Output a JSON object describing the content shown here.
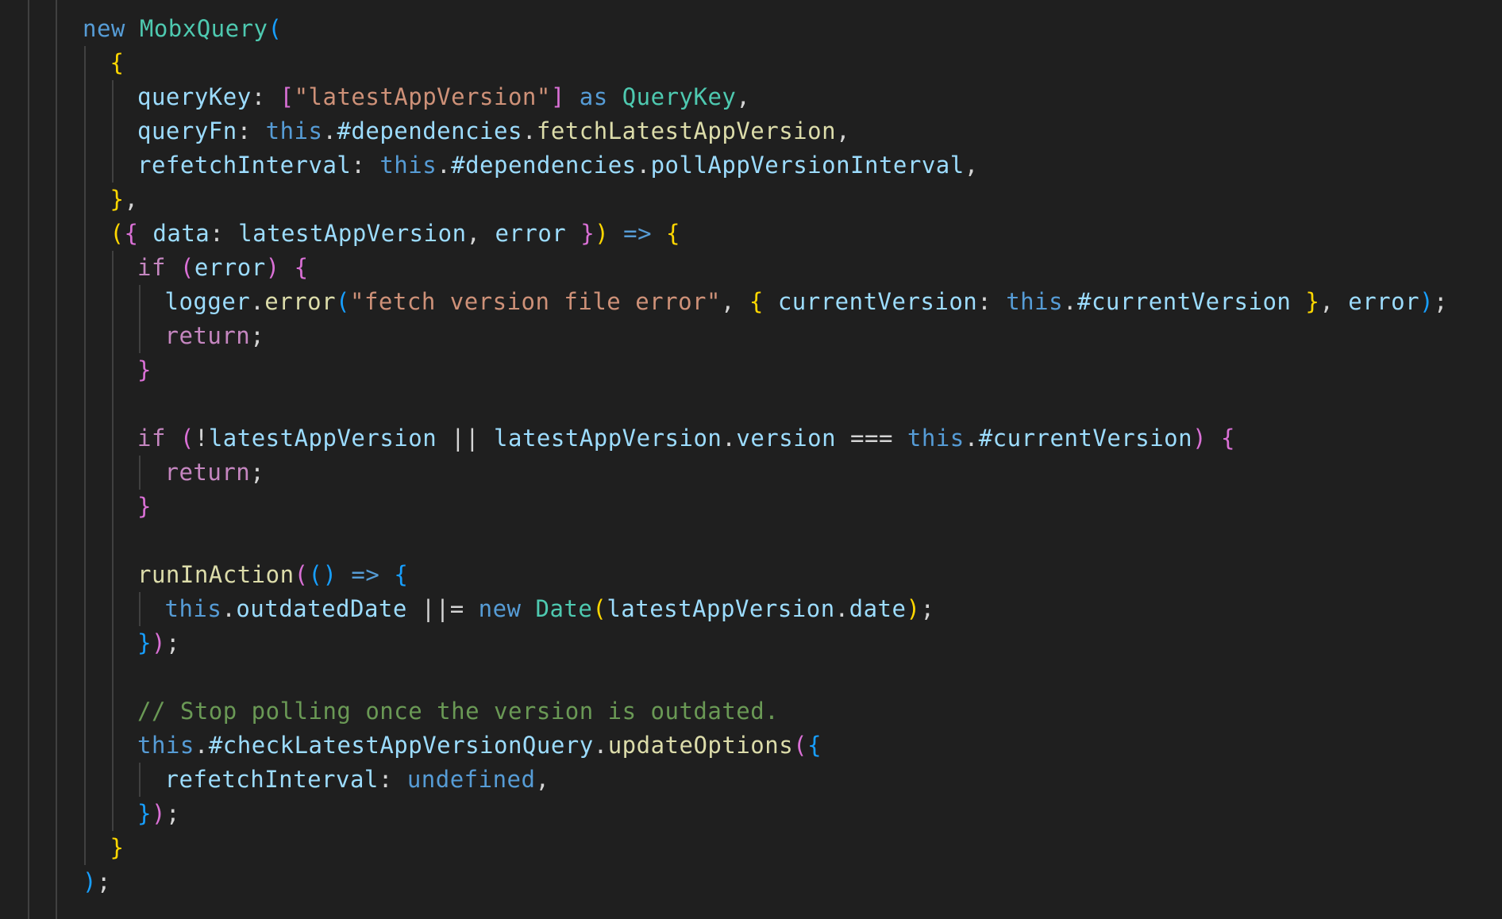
{
  "editor": {
    "language": "typescript",
    "theme": {
      "background": "#1f1f1f",
      "indent_guide": "#404040",
      "colors": {
        "keyword": "#569cd6",
        "control": "#c586c0",
        "type": "#4ec9b0",
        "variable": "#9cdcfe",
        "function": "#dcdcaa",
        "string": "#ce9178",
        "comment": "#6a9955",
        "punctuation": "#d4d4d4",
        "bracket1": "#ffd700",
        "bracket2": "#da70d6",
        "bracket3": "#179fff"
      }
    },
    "lines": [
      {
        "indent": 0,
        "tokens": [
          [
            "new",
            "keyword"
          ],
          [
            " ",
            "punctuation"
          ],
          [
            "MobxQuery",
            "type"
          ],
          [
            "(",
            "bracket3"
          ]
        ]
      },
      {
        "indent": 1,
        "tokens": [
          [
            "{",
            "bracket1"
          ]
        ]
      },
      {
        "indent": 2,
        "tokens": [
          [
            "queryKey",
            "variable"
          ],
          [
            ": ",
            "punctuation"
          ],
          [
            "[",
            "bracket2"
          ],
          [
            "\"latestAppVersion\"",
            "string"
          ],
          [
            "]",
            "bracket2"
          ],
          [
            " ",
            "punctuation"
          ],
          [
            "as",
            "keyword"
          ],
          [
            " ",
            "punctuation"
          ],
          [
            "QueryKey",
            "type"
          ],
          [
            ",",
            "punctuation"
          ]
        ]
      },
      {
        "indent": 2,
        "tokens": [
          [
            "queryFn",
            "variable"
          ],
          [
            ": ",
            "punctuation"
          ],
          [
            "this",
            "keyword"
          ],
          [
            ".",
            "punctuation"
          ],
          [
            "#dependencies",
            "variable"
          ],
          [
            ".",
            "punctuation"
          ],
          [
            "fetchLatestAppVersion",
            "function"
          ],
          [
            ",",
            "punctuation"
          ]
        ]
      },
      {
        "indent": 2,
        "tokens": [
          [
            "refetchInterval",
            "variable"
          ],
          [
            ": ",
            "punctuation"
          ],
          [
            "this",
            "keyword"
          ],
          [
            ".",
            "punctuation"
          ],
          [
            "#dependencies",
            "variable"
          ],
          [
            ".",
            "punctuation"
          ],
          [
            "pollAppVersionInterval",
            "variable"
          ],
          [
            ",",
            "punctuation"
          ]
        ]
      },
      {
        "indent": 1,
        "tokens": [
          [
            "}",
            "bracket1"
          ],
          [
            ",",
            "punctuation"
          ]
        ]
      },
      {
        "indent": 1,
        "tokens": [
          [
            "(",
            "bracket1"
          ],
          [
            "{",
            "bracket2"
          ],
          [
            " ",
            "punctuation"
          ],
          [
            "data",
            "variable"
          ],
          [
            ": ",
            "punctuation"
          ],
          [
            "latestAppVersion",
            "variable"
          ],
          [
            ", ",
            "punctuation"
          ],
          [
            "error",
            "variable"
          ],
          [
            " ",
            "punctuation"
          ],
          [
            "}",
            "bracket2"
          ],
          [
            ")",
            "bracket1"
          ],
          [
            " ",
            "punctuation"
          ],
          [
            "=>",
            "keyword"
          ],
          [
            " ",
            "punctuation"
          ],
          [
            "{",
            "bracket1"
          ]
        ]
      },
      {
        "indent": 2,
        "tokens": [
          [
            "if",
            "control"
          ],
          [
            " ",
            "punctuation"
          ],
          [
            "(",
            "bracket2"
          ],
          [
            "error",
            "variable"
          ],
          [
            ")",
            "bracket2"
          ],
          [
            " ",
            "punctuation"
          ],
          [
            "{",
            "bracket2"
          ]
        ]
      },
      {
        "indent": 3,
        "tokens": [
          [
            "logger",
            "variable"
          ],
          [
            ".",
            "punctuation"
          ],
          [
            "error",
            "function"
          ],
          [
            "(",
            "bracket3"
          ],
          [
            "\"fetch version file error\"",
            "string"
          ],
          [
            ", ",
            "punctuation"
          ],
          [
            "{",
            "bracket1"
          ],
          [
            " ",
            "punctuation"
          ],
          [
            "currentVersion",
            "variable"
          ],
          [
            ": ",
            "punctuation"
          ],
          [
            "this",
            "keyword"
          ],
          [
            ".",
            "punctuation"
          ],
          [
            "#currentVersion",
            "variable"
          ],
          [
            " ",
            "punctuation"
          ],
          [
            "}",
            "bracket1"
          ],
          [
            ", ",
            "punctuation"
          ],
          [
            "error",
            "variable"
          ],
          [
            ")",
            "bracket3"
          ],
          [
            ";",
            "punctuation"
          ]
        ]
      },
      {
        "indent": 3,
        "tokens": [
          [
            "return",
            "control"
          ],
          [
            ";",
            "punctuation"
          ]
        ]
      },
      {
        "indent": 2,
        "tokens": [
          [
            "}",
            "bracket2"
          ]
        ]
      },
      {
        "indent": 0,
        "tokens": []
      },
      {
        "indent": 2,
        "tokens": [
          [
            "if",
            "control"
          ],
          [
            " ",
            "punctuation"
          ],
          [
            "(",
            "bracket2"
          ],
          [
            "!",
            "punctuation"
          ],
          [
            "latestAppVersion",
            "variable"
          ],
          [
            " || ",
            "punctuation"
          ],
          [
            "latestAppVersion",
            "variable"
          ],
          [
            ".",
            "punctuation"
          ],
          [
            "version",
            "variable"
          ],
          [
            " === ",
            "punctuation"
          ],
          [
            "this",
            "keyword"
          ],
          [
            ".",
            "punctuation"
          ],
          [
            "#currentVersion",
            "variable"
          ],
          [
            ")",
            "bracket2"
          ],
          [
            " ",
            "punctuation"
          ],
          [
            "{",
            "bracket2"
          ]
        ]
      },
      {
        "indent": 3,
        "tokens": [
          [
            "return",
            "control"
          ],
          [
            ";",
            "punctuation"
          ]
        ]
      },
      {
        "indent": 2,
        "tokens": [
          [
            "}",
            "bracket2"
          ]
        ]
      },
      {
        "indent": 0,
        "tokens": []
      },
      {
        "indent": 2,
        "tokens": [
          [
            "runInAction",
            "function"
          ],
          [
            "(",
            "bracket2"
          ],
          [
            "()",
            "bracket3"
          ],
          [
            " ",
            "punctuation"
          ],
          [
            "=>",
            "keyword"
          ],
          [
            " ",
            "punctuation"
          ],
          [
            "{",
            "bracket3"
          ]
        ]
      },
      {
        "indent": 3,
        "tokens": [
          [
            "this",
            "keyword"
          ],
          [
            ".",
            "punctuation"
          ],
          [
            "outdatedDate",
            "variable"
          ],
          [
            " ||= ",
            "punctuation"
          ],
          [
            "new",
            "keyword"
          ],
          [
            " ",
            "punctuation"
          ],
          [
            "Date",
            "type"
          ],
          [
            "(",
            "bracket1"
          ],
          [
            "latestAppVersion",
            "variable"
          ],
          [
            ".",
            "punctuation"
          ],
          [
            "date",
            "variable"
          ],
          [
            ")",
            "bracket1"
          ],
          [
            ";",
            "punctuation"
          ]
        ]
      },
      {
        "indent": 2,
        "tokens": [
          [
            "}",
            "bracket3"
          ],
          [
            ")",
            "bracket2"
          ],
          [
            ";",
            "punctuation"
          ]
        ]
      },
      {
        "indent": 0,
        "tokens": []
      },
      {
        "indent": 2,
        "tokens": [
          [
            "// Stop polling once the version is outdated.",
            "comment"
          ]
        ]
      },
      {
        "indent": 2,
        "tokens": [
          [
            "this",
            "keyword"
          ],
          [
            ".",
            "punctuation"
          ],
          [
            "#checkLatestAppVersionQuery",
            "variable"
          ],
          [
            ".",
            "punctuation"
          ],
          [
            "updateOptions",
            "function"
          ],
          [
            "(",
            "bracket2"
          ],
          [
            "{",
            "bracket3"
          ]
        ]
      },
      {
        "indent": 3,
        "tokens": [
          [
            "refetchInterval",
            "variable"
          ],
          [
            ": ",
            "punctuation"
          ],
          [
            "undefined",
            "keyword"
          ],
          [
            ",",
            "punctuation"
          ]
        ]
      },
      {
        "indent": 2,
        "tokens": [
          [
            "}",
            "bracket3"
          ],
          [
            ")",
            "bracket2"
          ],
          [
            ";",
            "punctuation"
          ]
        ]
      },
      {
        "indent": 1,
        "tokens": [
          [
            "}",
            "bracket1"
          ]
        ]
      },
      {
        "indent": 0,
        "tokens": [
          [
            ")",
            "bracket3"
          ],
          [
            ";",
            "punctuation"
          ]
        ]
      }
    ]
  }
}
